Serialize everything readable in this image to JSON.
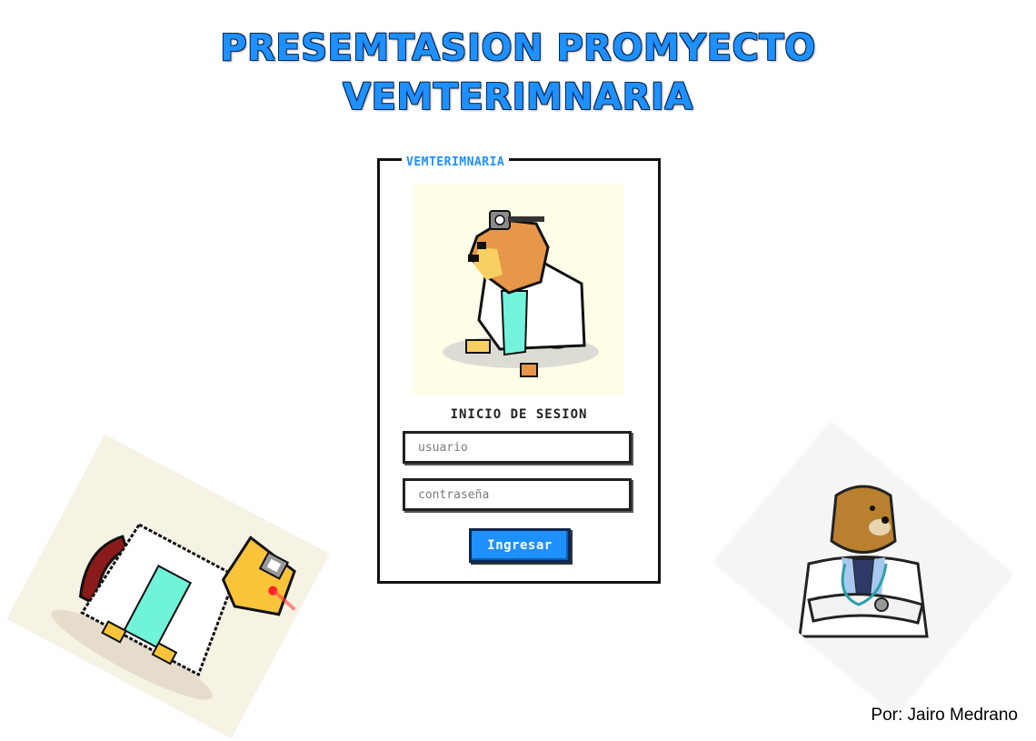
{
  "header": {
    "title_line1": "PRESEMTASION PROMYECTO",
    "title_line2": "VEMTERIMNARIA"
  },
  "login": {
    "legend": "VEMTERIMNARIA",
    "heading": "INICIO DE SESION",
    "username_placeholder": "usuario",
    "password_placeholder": "contraseña",
    "submit_label": "Ingresar"
  },
  "footer": {
    "author": "Por: Jairo Medrano"
  },
  "colors": {
    "accent": "#1e90ff",
    "border": "#111111"
  }
}
